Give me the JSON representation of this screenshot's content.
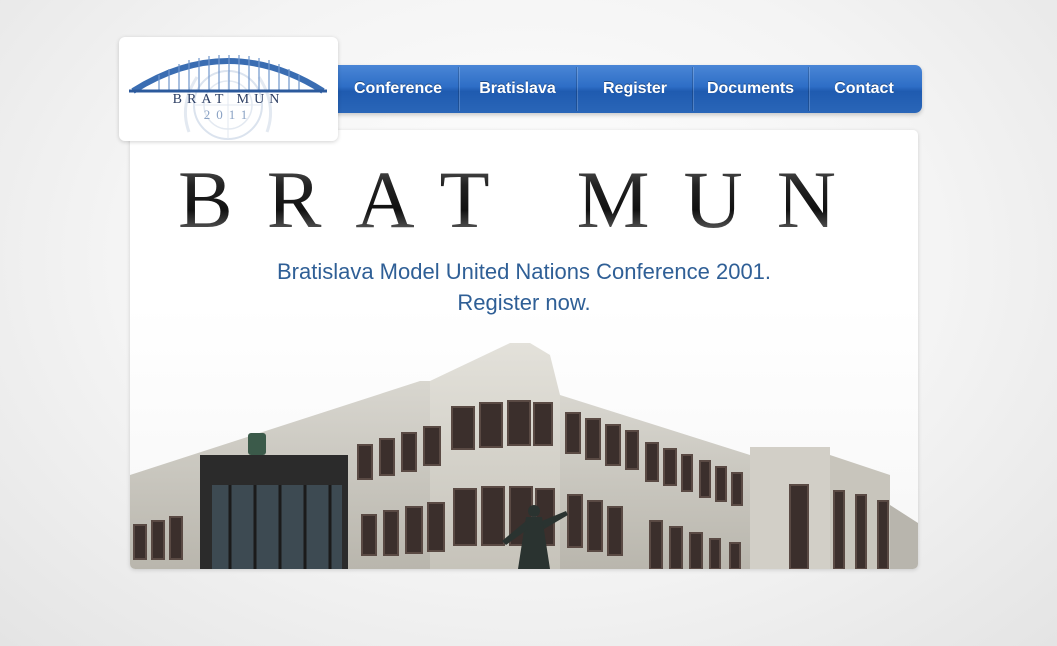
{
  "logo": {
    "word_top": "BRAT MUN",
    "word_bottom": "2011",
    "colors": {
      "arch": "#3a6db2",
      "emblem": "#c7d3e3"
    }
  },
  "nav": {
    "items": [
      {
        "label": "Conference"
      },
      {
        "label": "Bratislava"
      },
      {
        "label": "Register"
      },
      {
        "label": "Documents"
      },
      {
        "label": "Contact"
      }
    ],
    "colors": {
      "top": "#4a86d6",
      "bottom": "#1f5bb0"
    }
  },
  "hero": {
    "title": "BRAT MUN",
    "tagline_line1": "Bratislava Model United Nations Conference 2001.",
    "tagline_line2": "Register now.",
    "tagline_color": "#2f5f96",
    "image": "parliament-building"
  }
}
